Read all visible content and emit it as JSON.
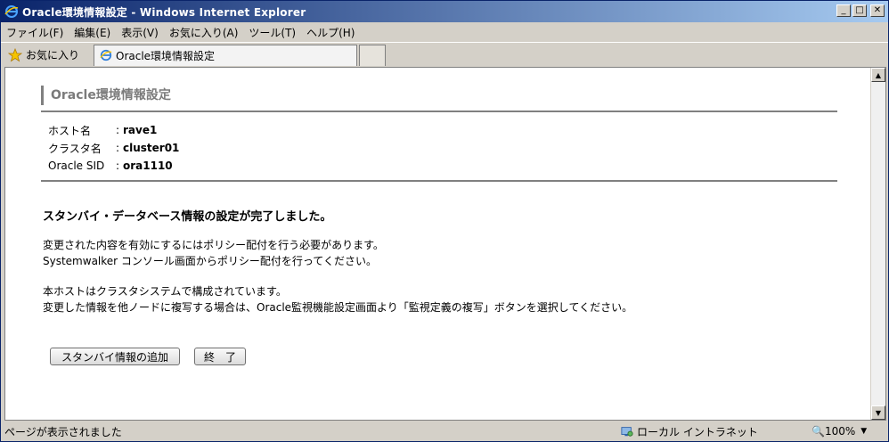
{
  "window": {
    "title": "Oracle環境情報設定 - Windows Internet Explorer"
  },
  "menu": [
    "ファイル(F)",
    "編集(E)",
    "表示(V)",
    "お気に入り(A)",
    "ツール(T)",
    "ヘルプ(H)"
  ],
  "favorites_label": "お気に入り",
  "tab_label": "Oracle環境情報設定",
  "page": {
    "heading": "Oracle環境情報設定",
    "info": [
      {
        "label": "ホスト名",
        "sep": ":",
        "value": "rave1"
      },
      {
        "label": "クラスタ名",
        "sep": ":",
        "value": "cluster01"
      },
      {
        "label": "Oracle SID",
        "sep": ":",
        "value": "ora1110"
      }
    ],
    "message": "スタンバイ・データベース情報の設定が完了しました。",
    "para1_line1": "変更された内容を有効にするにはポリシー配付を行う必要があります。",
    "para1_line2": "Systemwalker コンソール画面からポリシー配付を行ってください。",
    "para2_line1": "本ホストはクラスタシステムで構成されています。",
    "para2_line2": "変更した情報を他ノードに複写する場合は、Oracle監視機能設定画面より「監視定義の複写」ボタンを選択してください。",
    "buttons": {
      "add": "スタンバイ情報の追加",
      "end": "終　了"
    }
  },
  "status": {
    "text": "ページが表示されました",
    "zone": "ローカル イントラネット",
    "zoom": "100%"
  },
  "colors": {
    "title_start": "#0a246a",
    "title_end": "#a6caf0",
    "heading": "#7b7b7b"
  }
}
